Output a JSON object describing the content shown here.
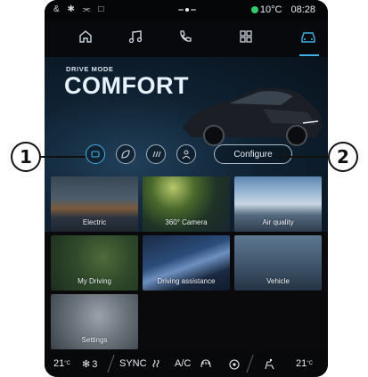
{
  "callouts": {
    "one": "1",
    "two": "2"
  },
  "status": {
    "left_icons": "& ✱ ⫘ □",
    "temperature": "10°C",
    "time": "08:28"
  },
  "nav": {
    "icons": [
      "home-icon",
      "music-icon",
      "phone-icon",
      "apps-icon",
      "car-icon"
    ],
    "active": "car-icon"
  },
  "hero": {
    "kicker": "DRIVE MODE",
    "title": "COMFORT"
  },
  "modes": {
    "buttons": [
      "car-mode-icon",
      "leaf-mode-icon",
      "sport-mode-icon",
      "profile-mode-icon"
    ],
    "active": "car-mode-icon",
    "configure_label": "Configure"
  },
  "tiles": {
    "electric": "Electric",
    "camera": "360° Camera",
    "air": "Air quality",
    "my_driving": "My Driving",
    "assist": "Driving assistance",
    "vehicle": "Vehicle",
    "settings": "Settings"
  },
  "bottom": {
    "temp_left": "21",
    "temp_unit": "°C",
    "fan": "3",
    "sync": "SYNC",
    "ac": "A/C",
    "temp_right": "21"
  },
  "colors": {
    "accent": "#3fb2e8",
    "status_green": "#35c86a"
  }
}
